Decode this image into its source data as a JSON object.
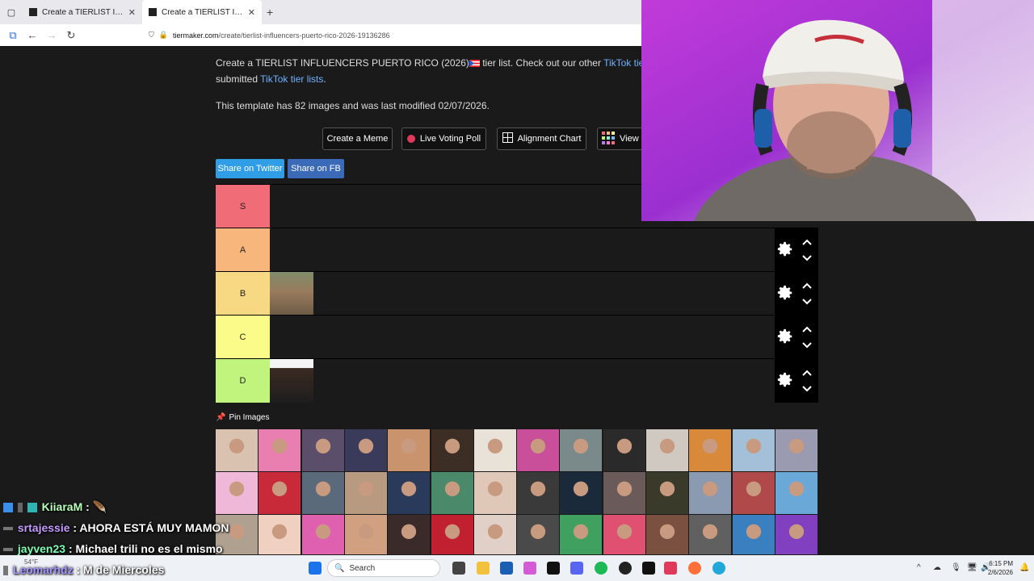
{
  "browser": {
    "tabs": [
      {
        "title": "Create a TIERLIST INFLUENCERS",
        "active": false
      },
      {
        "title": "Create a TIERLIST INFLUENCERS",
        "active": true
      }
    ],
    "new_tab": "+",
    "url_host": "tiermaker.com",
    "url_path": "/create/tierlist-influencers-puerto-rico-2026-19136286"
  },
  "page": {
    "intro_prefix": "Create a TIERLIST INFLUENCERS PUERTO RICO (2026)",
    "intro_middle": " tier list. Check out our other ",
    "intro_link1": "TikTok tier list",
    "intro_line2_prefix": "submitted ",
    "intro_link2": "TikTok tier lists",
    "intro_line2_suffix": ".",
    "template_info": "This template has 82 images and was last modified 02/07/2026.",
    "buttons": {
      "meme": "Create a Meme",
      "poll": "Live Voting Poll",
      "alignment": "Alignment Chart",
      "view": "View"
    },
    "share_twitter": "Share on Twitter",
    "share_fb": "Share on FB",
    "pin_images": "Pin Images"
  },
  "tiers": [
    {
      "label": "S",
      "color": "#f06c76",
      "items": 0
    },
    {
      "label": "A",
      "color": "#f7b77c",
      "items": 0
    },
    {
      "label": "B",
      "color": "#f7d983",
      "items": 1
    },
    {
      "label": "C",
      "color": "#fbfb8a",
      "items": 0
    },
    {
      "label": "D",
      "color": "#c1f47d",
      "items": 1
    }
  ],
  "chat": [
    {
      "user": "KiiaraM",
      "sep": " : ",
      "message": "",
      "color": "#b8ffb8"
    },
    {
      "user": "srtajessie",
      "sep": " : ",
      "message": "AHORA ESTÁ MUY MAMON",
      "color": "#c49bff"
    },
    {
      "user": "jayven23",
      "sep": " : ",
      "message": "Michael trili no es el mismo",
      "color": "#7dffb5"
    },
    {
      "user": "Leomarhdz",
      "sep": " : ",
      "message": "M de Miercoles",
      "color": "#a394ff"
    }
  ],
  "taskbar": {
    "weather": "54°F",
    "search": "Search",
    "time": "6:15 PM",
    "date": "2/6/2026"
  }
}
